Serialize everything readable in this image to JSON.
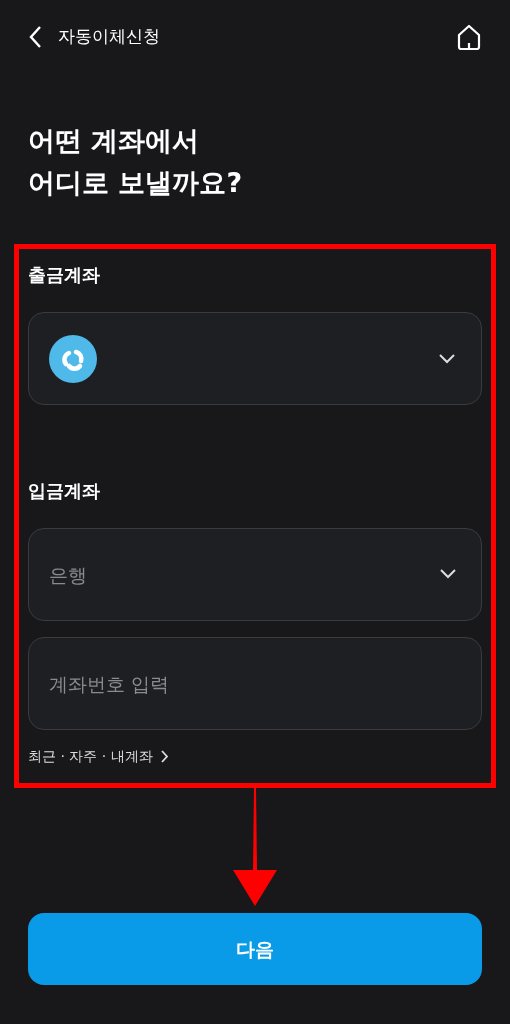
{
  "header": {
    "title": "자동이체신청"
  },
  "heading": {
    "lines": [
      "어떤 계좌에서",
      "어디로 보낼까요?"
    ]
  },
  "annotation": {
    "kind": "box-arrow"
  },
  "withdraw": {
    "label": "출금계좌"
  },
  "deposit": {
    "label": "입금계좌",
    "bank": {
      "placeholder": "은행"
    },
    "account": {
      "placeholder": "계좌번호 입력"
    },
    "shortcut": "최근 · 자주 · 내계좌"
  },
  "next_button": "다음"
}
